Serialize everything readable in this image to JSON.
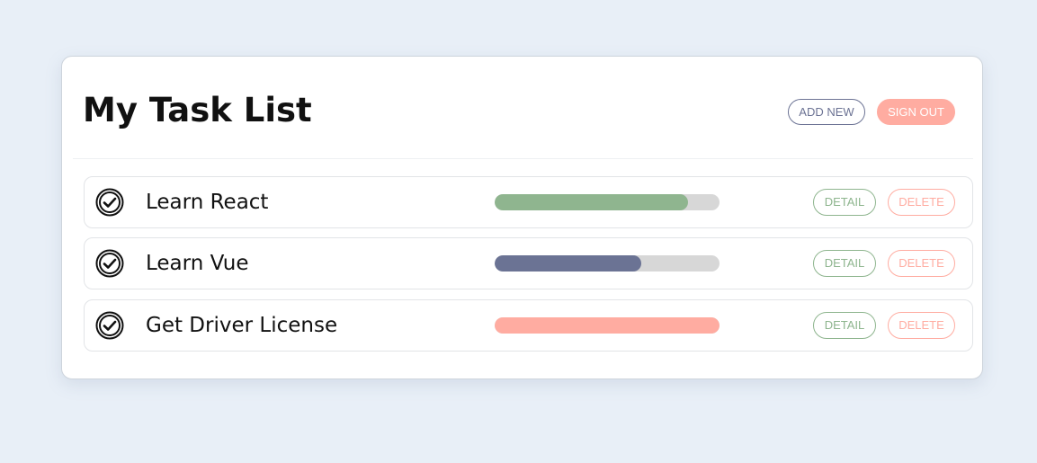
{
  "header": {
    "title": "My Task List",
    "add_new_label": "ADD NEW",
    "sign_out_label": "SIGN OUT"
  },
  "tasks": [
    {
      "title": "Learn React",
      "progress": 0.86,
      "progress_color": "#8fb58f",
      "status_icon": "check-circle-icon",
      "detail_label": "DETAIL",
      "delete_label": "DELETE"
    },
    {
      "title": "Learn Vue",
      "progress": 0.65,
      "progress_color": "#6b7394",
      "status_icon": "check-circle-icon",
      "detail_label": "DETAIL",
      "delete_label": "DELETE"
    },
    {
      "title": "Get Driver License",
      "progress": 1.0,
      "progress_color": "#ffaca1",
      "status_icon": "check-circle-icon",
      "detail_label": "DETAIL",
      "delete_label": "DELETE"
    }
  ],
  "colors": {
    "background": "#e8eff7",
    "add_new": "#6c7394",
    "sign_out": "#ffaca1",
    "detail": "#8eb58e",
    "delete": "#ffaca1",
    "track": "#d7d7d7"
  }
}
